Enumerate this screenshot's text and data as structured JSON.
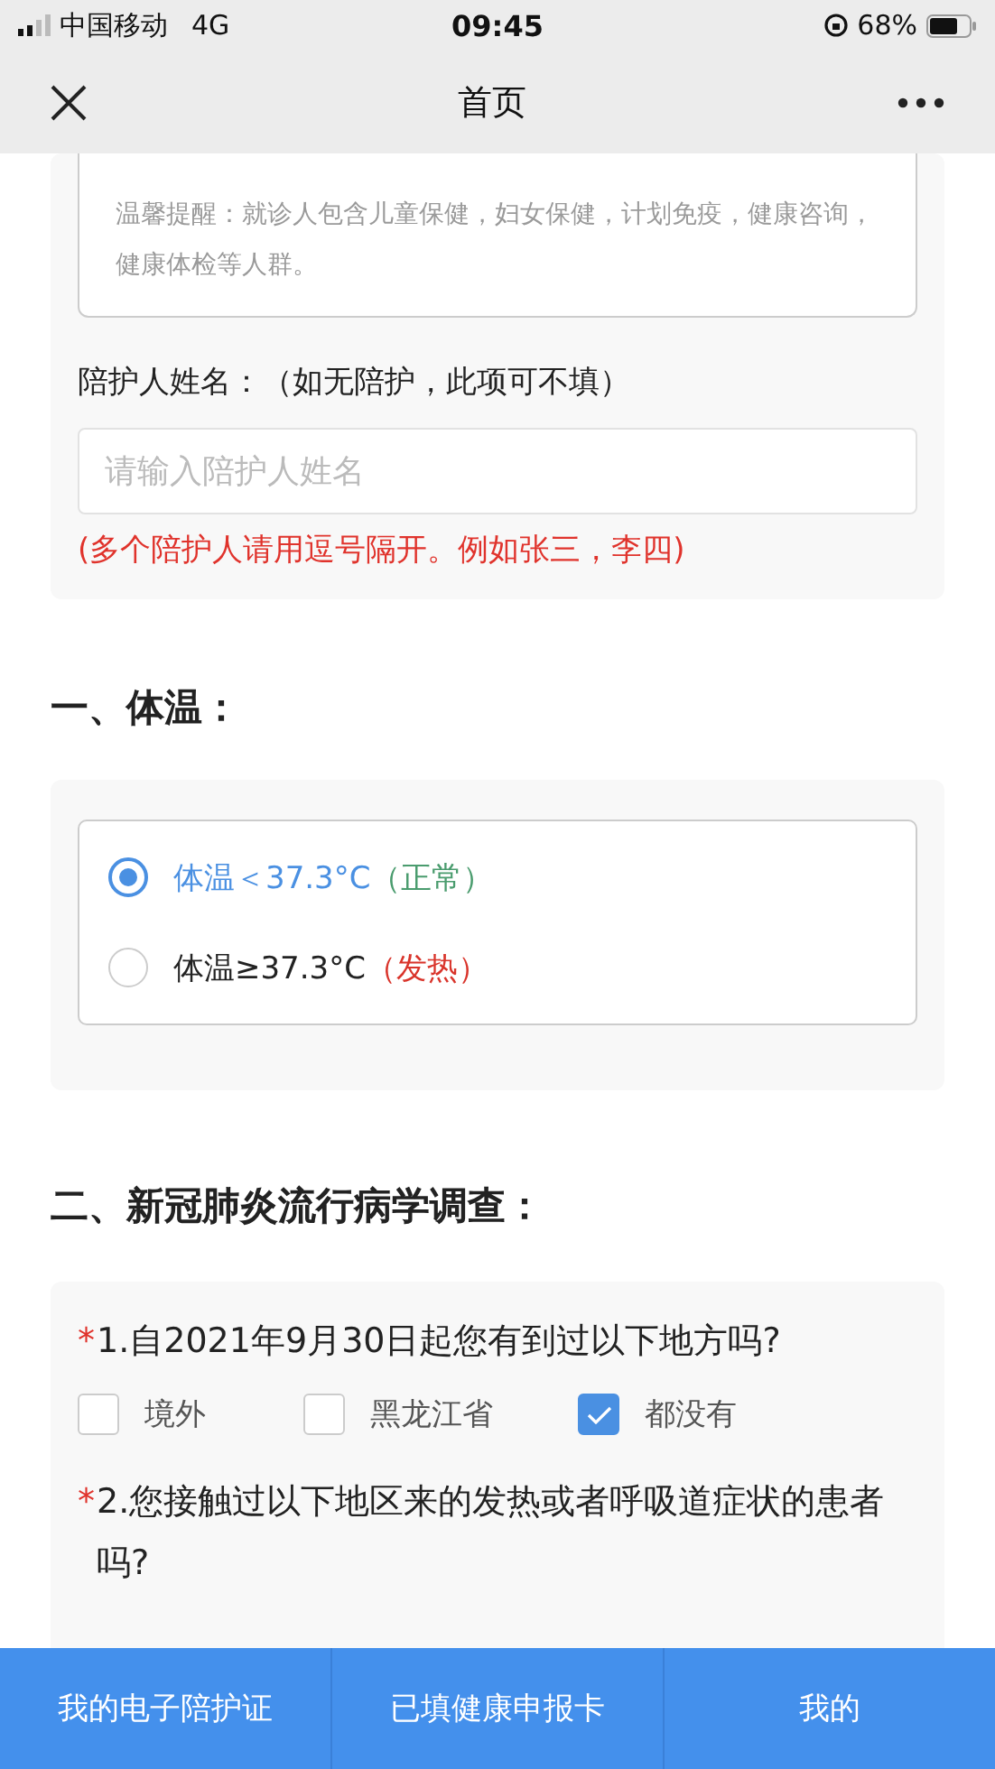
{
  "status_bar": {
    "carrier": "中国移动",
    "network": "4G",
    "time": "09:45",
    "battery": "68%"
  },
  "nav": {
    "title": "首页"
  },
  "companion_card": {
    "hint": "温馨提醒：就诊人包含儿童保健，妇女保健，计划免疫，健康咨询，健康体检等人群。",
    "label": "陪护人姓名：（如无陪护，此项可不填）",
    "placeholder": "请输入陪护人姓名",
    "note": "(多个陪护人请用逗号隔开。例如张三，李四)"
  },
  "temperature": {
    "heading": "一、体温：",
    "options": [
      {
        "label": "体温＜37.3°C",
        "note": "（正常）",
        "color": "#4a9c6e",
        "selected": true
      },
      {
        "label": "体温≥37.3°C",
        "note": "（发热）",
        "color": "#d9342b",
        "selected": false
      }
    ]
  },
  "survey": {
    "heading": "二、新冠肺炎流行病学调查：",
    "questions": [
      {
        "marker": "*",
        "text": "1.自2021年9月30日起您有到过以下地方吗?",
        "options": [
          {
            "label": "境外",
            "checked": false
          },
          {
            "label": "黑龙江省",
            "checked": false
          },
          {
            "label": "都没有",
            "checked": true
          }
        ]
      },
      {
        "marker": "*",
        "text": "2.您接触过以下地区来的发热或者呼吸道症状的患者吗?"
      }
    ]
  },
  "tab_bar": [
    "我的电子陪护证",
    "已填健康申报卡",
    "我的"
  ]
}
